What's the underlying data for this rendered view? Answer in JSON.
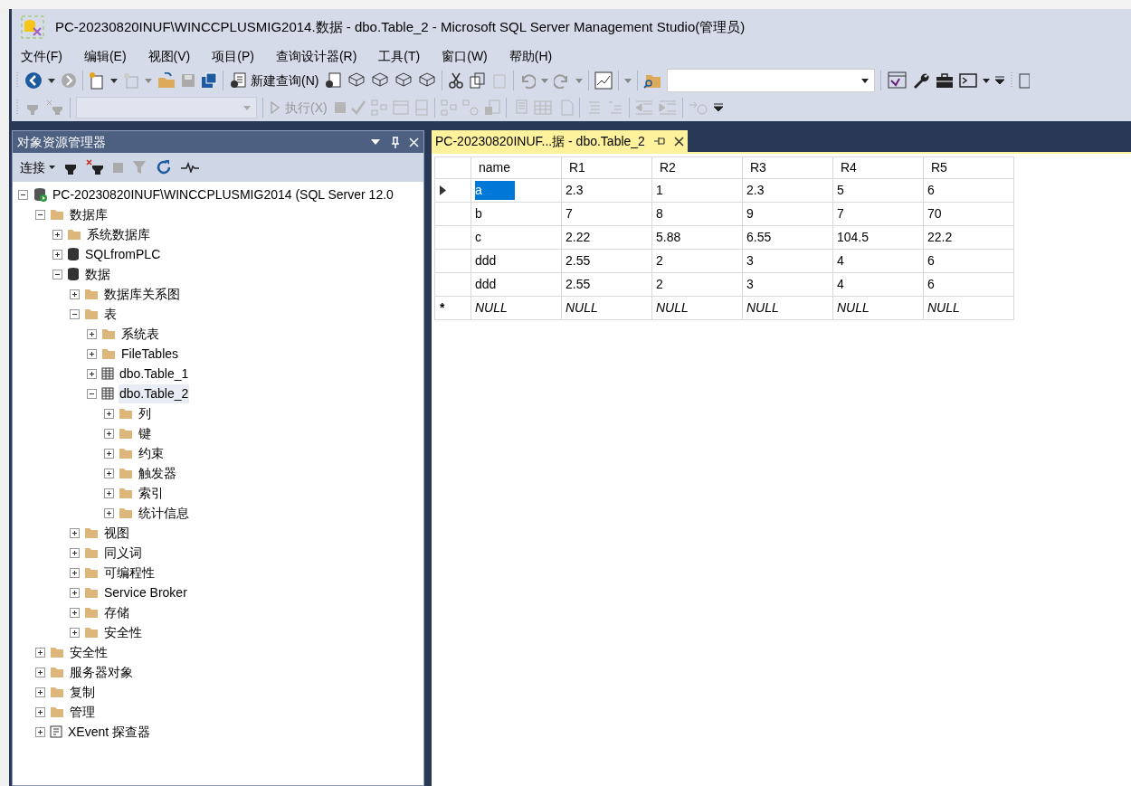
{
  "window": {
    "title": "PC-20230820INUF\\WINCCPLUSMIG2014.数据 - dbo.Table_2 - Microsoft SQL Server Management Studio(管理员)"
  },
  "menu": [
    "文件(F)",
    "编辑(E)",
    "视图(V)",
    "项目(P)",
    "查询设计器(R)",
    "工具(T)",
    "窗口(W)",
    "帮助(H)"
  ],
  "toolbar": {
    "new_query": "新建查询(N)",
    "execute": {
      "label": "执行(X)",
      "disabled": true
    }
  },
  "object_explorer": {
    "title": "对象资源管理器",
    "connect": "连接",
    "tree": [
      {
        "label": "PC-20230820INUF\\WINCCPLUSMIG2014 (SQL Server 12.0",
        "kind": "server",
        "expanded": true,
        "children": [
          {
            "label": "数据库",
            "kind": "folder",
            "expanded": true,
            "children": [
              {
                "label": "系统数据库",
                "kind": "folder",
                "expanded": false
              },
              {
                "label": "SQLfromPLC",
                "kind": "database",
                "expanded": false
              },
              {
                "label": "数据",
                "kind": "database",
                "expanded": true,
                "children": [
                  {
                    "label": "数据库关系图",
                    "kind": "folder",
                    "expanded": false
                  },
                  {
                    "label": "表",
                    "kind": "folder",
                    "expanded": true,
                    "children": [
                      {
                        "label": "系统表",
                        "kind": "folder",
                        "expanded": false
                      },
                      {
                        "label": "FileTables",
                        "kind": "folder",
                        "expanded": false
                      },
                      {
                        "label": "dbo.Table_1",
                        "kind": "table",
                        "expanded": false
                      },
                      {
                        "label": "dbo.Table_2",
                        "kind": "table",
                        "expanded": true,
                        "selected": true,
                        "children": [
                          {
                            "label": "列",
                            "kind": "folder",
                            "expanded": false
                          },
                          {
                            "label": "键",
                            "kind": "folder",
                            "expanded": false
                          },
                          {
                            "label": "约束",
                            "kind": "folder",
                            "expanded": false
                          },
                          {
                            "label": "触发器",
                            "kind": "folder",
                            "expanded": false
                          },
                          {
                            "label": "索引",
                            "kind": "folder",
                            "expanded": false
                          },
                          {
                            "label": "统计信息",
                            "kind": "folder",
                            "expanded": false
                          }
                        ]
                      }
                    ]
                  },
                  {
                    "label": "视图",
                    "kind": "folder",
                    "expanded": false
                  },
                  {
                    "label": "同义词",
                    "kind": "folder",
                    "expanded": false
                  },
                  {
                    "label": "可编程性",
                    "kind": "folder",
                    "expanded": false
                  },
                  {
                    "label": "Service Broker",
                    "kind": "folder",
                    "expanded": false
                  },
                  {
                    "label": "存储",
                    "kind": "folder",
                    "expanded": false
                  },
                  {
                    "label": "安全性",
                    "kind": "folder",
                    "expanded": false
                  }
                ]
              }
            ]
          },
          {
            "label": "安全性",
            "kind": "folder",
            "expanded": false
          },
          {
            "label": "服务器对象",
            "kind": "folder",
            "expanded": false
          },
          {
            "label": "复制",
            "kind": "folder",
            "expanded": false
          },
          {
            "label": "管理",
            "kind": "folder",
            "expanded": false
          },
          {
            "label": "XEvent 探查器",
            "kind": "xevent",
            "expanded": false
          }
        ]
      }
    ]
  },
  "document": {
    "tab": "PC-20230820INUF...据 - dbo.Table_2",
    "columns": [
      "name",
      "R1",
      "R2",
      "R3",
      "R4",
      "R5"
    ],
    "rows": [
      {
        "current": true,
        "cells": [
          {
            "text": "a",
            "selected": true
          },
          {
            "text": "2.3",
            "selected": false
          },
          {
            "text": "1",
            "selected": false
          },
          {
            "text": "2.3",
            "selected": false
          },
          {
            "text": "5",
            "selected": false
          },
          {
            "text": "6",
            "selected": false
          }
        ]
      },
      {
        "current": false,
        "cells": [
          {
            "text": "b",
            "selected": false
          },
          {
            "text": "7",
            "selected": false
          },
          {
            "text": "8",
            "selected": false
          },
          {
            "text": "9",
            "selected": false
          },
          {
            "text": "7",
            "selected": false
          },
          {
            "text": "70",
            "selected": false
          }
        ]
      },
      {
        "current": false,
        "cells": [
          {
            "text": "c",
            "selected": false
          },
          {
            "text": "2.22",
            "selected": false
          },
          {
            "text": "5.88",
            "selected": false
          },
          {
            "text": "6.55",
            "selected": false
          },
          {
            "text": "104.5",
            "selected": false
          },
          {
            "text": "22.2",
            "selected": false
          }
        ]
      },
      {
        "current": false,
        "cells": [
          {
            "text": "ddd",
            "selected": false
          },
          {
            "text": "2.55",
            "selected": false
          },
          {
            "text": "2",
            "selected": false
          },
          {
            "text": "3",
            "selected": false
          },
          {
            "text": "4",
            "selected": false
          },
          {
            "text": "6",
            "selected": false
          }
        ]
      },
      {
        "current": false,
        "cells": [
          {
            "text": "ddd",
            "selected": false
          },
          {
            "text": "2.55",
            "selected": false
          },
          {
            "text": "2",
            "selected": false
          },
          {
            "text": "3",
            "selected": false
          },
          {
            "text": "4",
            "selected": false
          },
          {
            "text": "6",
            "selected": false
          }
        ]
      },
      {
        "current": false,
        "kind": "new",
        "marker": "*",
        "cells": [
          {
            "text": "NULL",
            "selected": false
          },
          {
            "text": "NULL",
            "selected": false
          },
          {
            "text": "NULL",
            "selected": false
          },
          {
            "text": "NULL",
            "selected": false
          },
          {
            "text": "NULL",
            "selected": false
          },
          {
            "text": "NULL",
            "selected": false
          }
        ]
      }
    ]
  }
}
